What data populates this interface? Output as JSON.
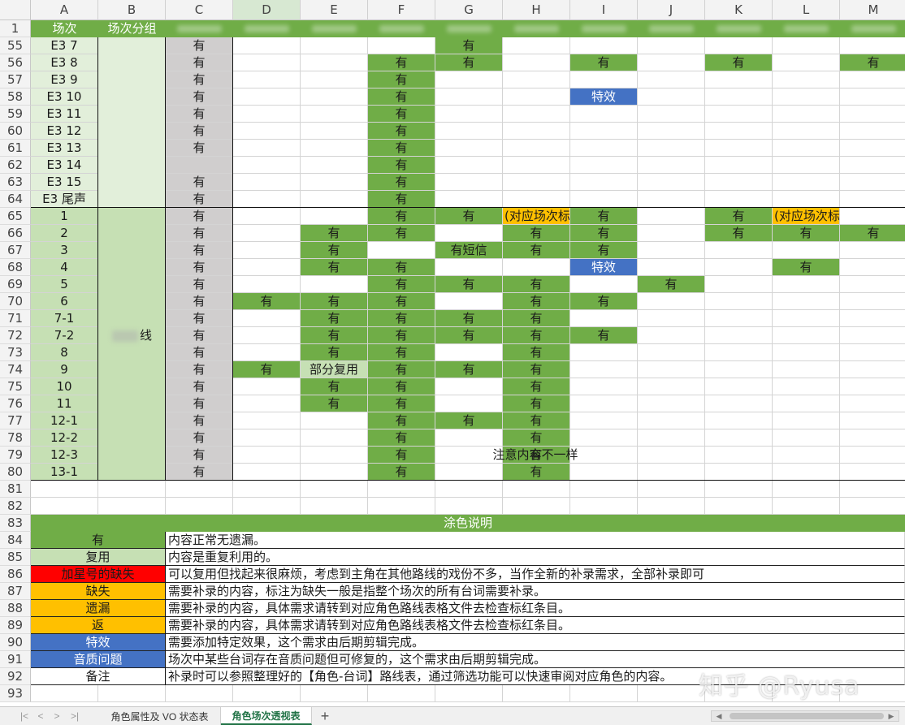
{
  "columns": [
    "A",
    "B",
    "C",
    "D",
    "E",
    "F",
    "G",
    "H",
    "I",
    "J",
    "K",
    "L",
    "M"
  ],
  "selected_column": "D",
  "header_row": {
    "number": "1",
    "a": "场次",
    "b": "场次分组"
  },
  "rows": [
    {
      "n": "55",
      "a": "E3 7",
      "c": "有",
      "cells": {
        "G": "有"
      }
    },
    {
      "n": "56",
      "a": "E3 8",
      "c": "有",
      "cells": {
        "F": "有",
        "G": "有",
        "I": "有",
        "K": "有",
        "M": "有"
      }
    },
    {
      "n": "57",
      "a": "E3 9",
      "c": "有",
      "cells": {
        "F": "有"
      }
    },
    {
      "n": "58",
      "a": "E3 10",
      "c": "有",
      "cells": {
        "F": "有",
        "I": "特效"
      }
    },
    {
      "n": "59",
      "a": "E3 11",
      "c": "有",
      "cells": {
        "F": "有"
      }
    },
    {
      "n": "60",
      "a": "E3 12",
      "c": "有",
      "cells": {
        "F": "有"
      }
    },
    {
      "n": "61",
      "a": "E3 13",
      "c": "有",
      "cells": {
        "F": "有"
      }
    },
    {
      "n": "62",
      "a": "E3 14",
      "c": "",
      "cells": {
        "F": "有"
      }
    },
    {
      "n": "63",
      "a": "E3 15",
      "c": "有",
      "cells": {
        "F": "有"
      }
    },
    {
      "n": "64",
      "a": "E3 尾声",
      "c": "有",
      "cells": {
        "F": "有"
      }
    },
    {
      "n": "65",
      "a": "1",
      "c": "有",
      "cells": {
        "F": "有",
        "G": "有",
        "H": "(对应场次标红)",
        "I": "有",
        "K": "有",
        "L": "(对应场次标红)"
      }
    },
    {
      "n": "66",
      "a": "2",
      "c": "有",
      "cells": {
        "E": "有",
        "F": "有",
        "H": "有",
        "I": "有",
        "K": "有",
        "L": "有",
        "M": "有"
      }
    },
    {
      "n": "67",
      "a": "3",
      "c": "有",
      "cells": {
        "E": "有",
        "G": "有短信",
        "H": "有",
        "I": "有"
      }
    },
    {
      "n": "68",
      "a": "4",
      "c": "有",
      "cells": {
        "E": "有",
        "F": "有",
        "I": "特效",
        "L": "有"
      }
    },
    {
      "n": "69",
      "a": "5",
      "c": "有",
      "cells": {
        "F": "有",
        "G": "有",
        "H": "有",
        "J": "有"
      }
    },
    {
      "n": "70",
      "a": "6",
      "c": "有",
      "cells": {
        "D": "有",
        "E": "有",
        "F": "有",
        "H": "有",
        "I": "有"
      }
    },
    {
      "n": "71",
      "a": "7-1",
      "c": "有",
      "cells": {
        "E": "有",
        "F": "有",
        "G": "有",
        "H": "有"
      }
    },
    {
      "n": "72",
      "a": "7-2",
      "c": "有",
      "cells": {
        "E": "有",
        "F": "有",
        "G": "有",
        "H": "有",
        "I": "有"
      }
    },
    {
      "n": "73",
      "a": "8",
      "c": "有",
      "cells": {
        "E": "有",
        "F": "有",
        "H": "有"
      }
    },
    {
      "n": "74",
      "a": "9",
      "c": "有",
      "cells": {
        "D": "有",
        "E": "部分复用",
        "F": "有",
        "G": "有",
        "H": "有"
      }
    },
    {
      "n": "75",
      "a": "10",
      "c": "有",
      "cells": {
        "E": "有",
        "F": "有",
        "H": "有"
      }
    },
    {
      "n": "76",
      "a": "11",
      "c": "有",
      "cells": {
        "E": "有",
        "F": "有",
        "H": "有"
      }
    },
    {
      "n": "77",
      "a": "12-1",
      "c": "有",
      "cells": {
        "F": "有",
        "G": "有",
        "H": "有"
      }
    },
    {
      "n": "78",
      "a": "12-2",
      "c": "有",
      "cells": {
        "F": "有",
        "H": "有"
      }
    },
    {
      "n": "79",
      "a": "12-3",
      "c": "有",
      "cells": {
        "F": "有",
        "H": "有"
      }
    },
    {
      "n": "80",
      "a": "13-1",
      "c": "有",
      "cells": {
        "F": "有",
        "H": "有"
      }
    }
  ],
  "group_label_suffix": "线",
  "note_79": "注意内容不一样",
  "empty_rows": [
    "81",
    "82"
  ],
  "legend_title": "涂色说明",
  "legend_title_row": "83",
  "legend": [
    {
      "n": "84",
      "label": "有",
      "color": "#70ad47",
      "desc": "内容正常无遗漏。"
    },
    {
      "n": "85",
      "label": "复用",
      "color": "#c6e0b4",
      "desc": "内容是重复利用的。"
    },
    {
      "n": "86",
      "label": "加星号的缺失",
      "color": "#ff0000",
      "desc": "可以复用但找起来很麻烦，考虑到主角在其他路线的戏份不多，当作全新的补录需求，全部补录即可"
    },
    {
      "n": "87",
      "label": "缺失",
      "color": "#ffc000",
      "desc": "需要补录的内容，标注为缺失一般是指整个场次的所有台词需要补录。"
    },
    {
      "n": "88",
      "label": "遗漏",
      "color": "#ffc000",
      "desc": "需要补录的内容，具体需求请转到对应角色路线表格文件去检查标红条目。"
    },
    {
      "n": "89",
      "label": "返",
      "color": "#ffc000",
      "desc": "需要补录的内容，具体需求请转到对应角色路线表格文件去检查标红条目。"
    },
    {
      "n": "90",
      "label": "特效",
      "color": "#4472c4",
      "desc": "需要添加特定效果，这个需求由后期剪辑完成。"
    },
    {
      "n": "91",
      "label": "音质问题",
      "color": "#4472c4",
      "desc": "场次中某些台词存在音质问题但可修复的，这个需求由后期剪辑完成。"
    },
    {
      "n": "92",
      "label": "备注",
      "color": "#ffffff",
      "desc": "补录时可以参照整理好的【角色-台词】路线表，通过筛选功能可以快速审阅对应角色的内容。"
    }
  ],
  "last_row": "93",
  "tabs": [
    {
      "label": "角色属性及 VO 状态表",
      "active": false
    },
    {
      "label": "角色场次透视表",
      "active": true
    }
  ],
  "add_tab_label": "+",
  "watermark": "知乎 @Ryusa",
  "colors": {
    "green": "#70ad47",
    "light_green": "#c6e0b4",
    "pale_green": "#e2efda",
    "gray": "#d0cece",
    "blue": "#4472c4",
    "orange": "#ffc000",
    "red": "#ff0000"
  }
}
